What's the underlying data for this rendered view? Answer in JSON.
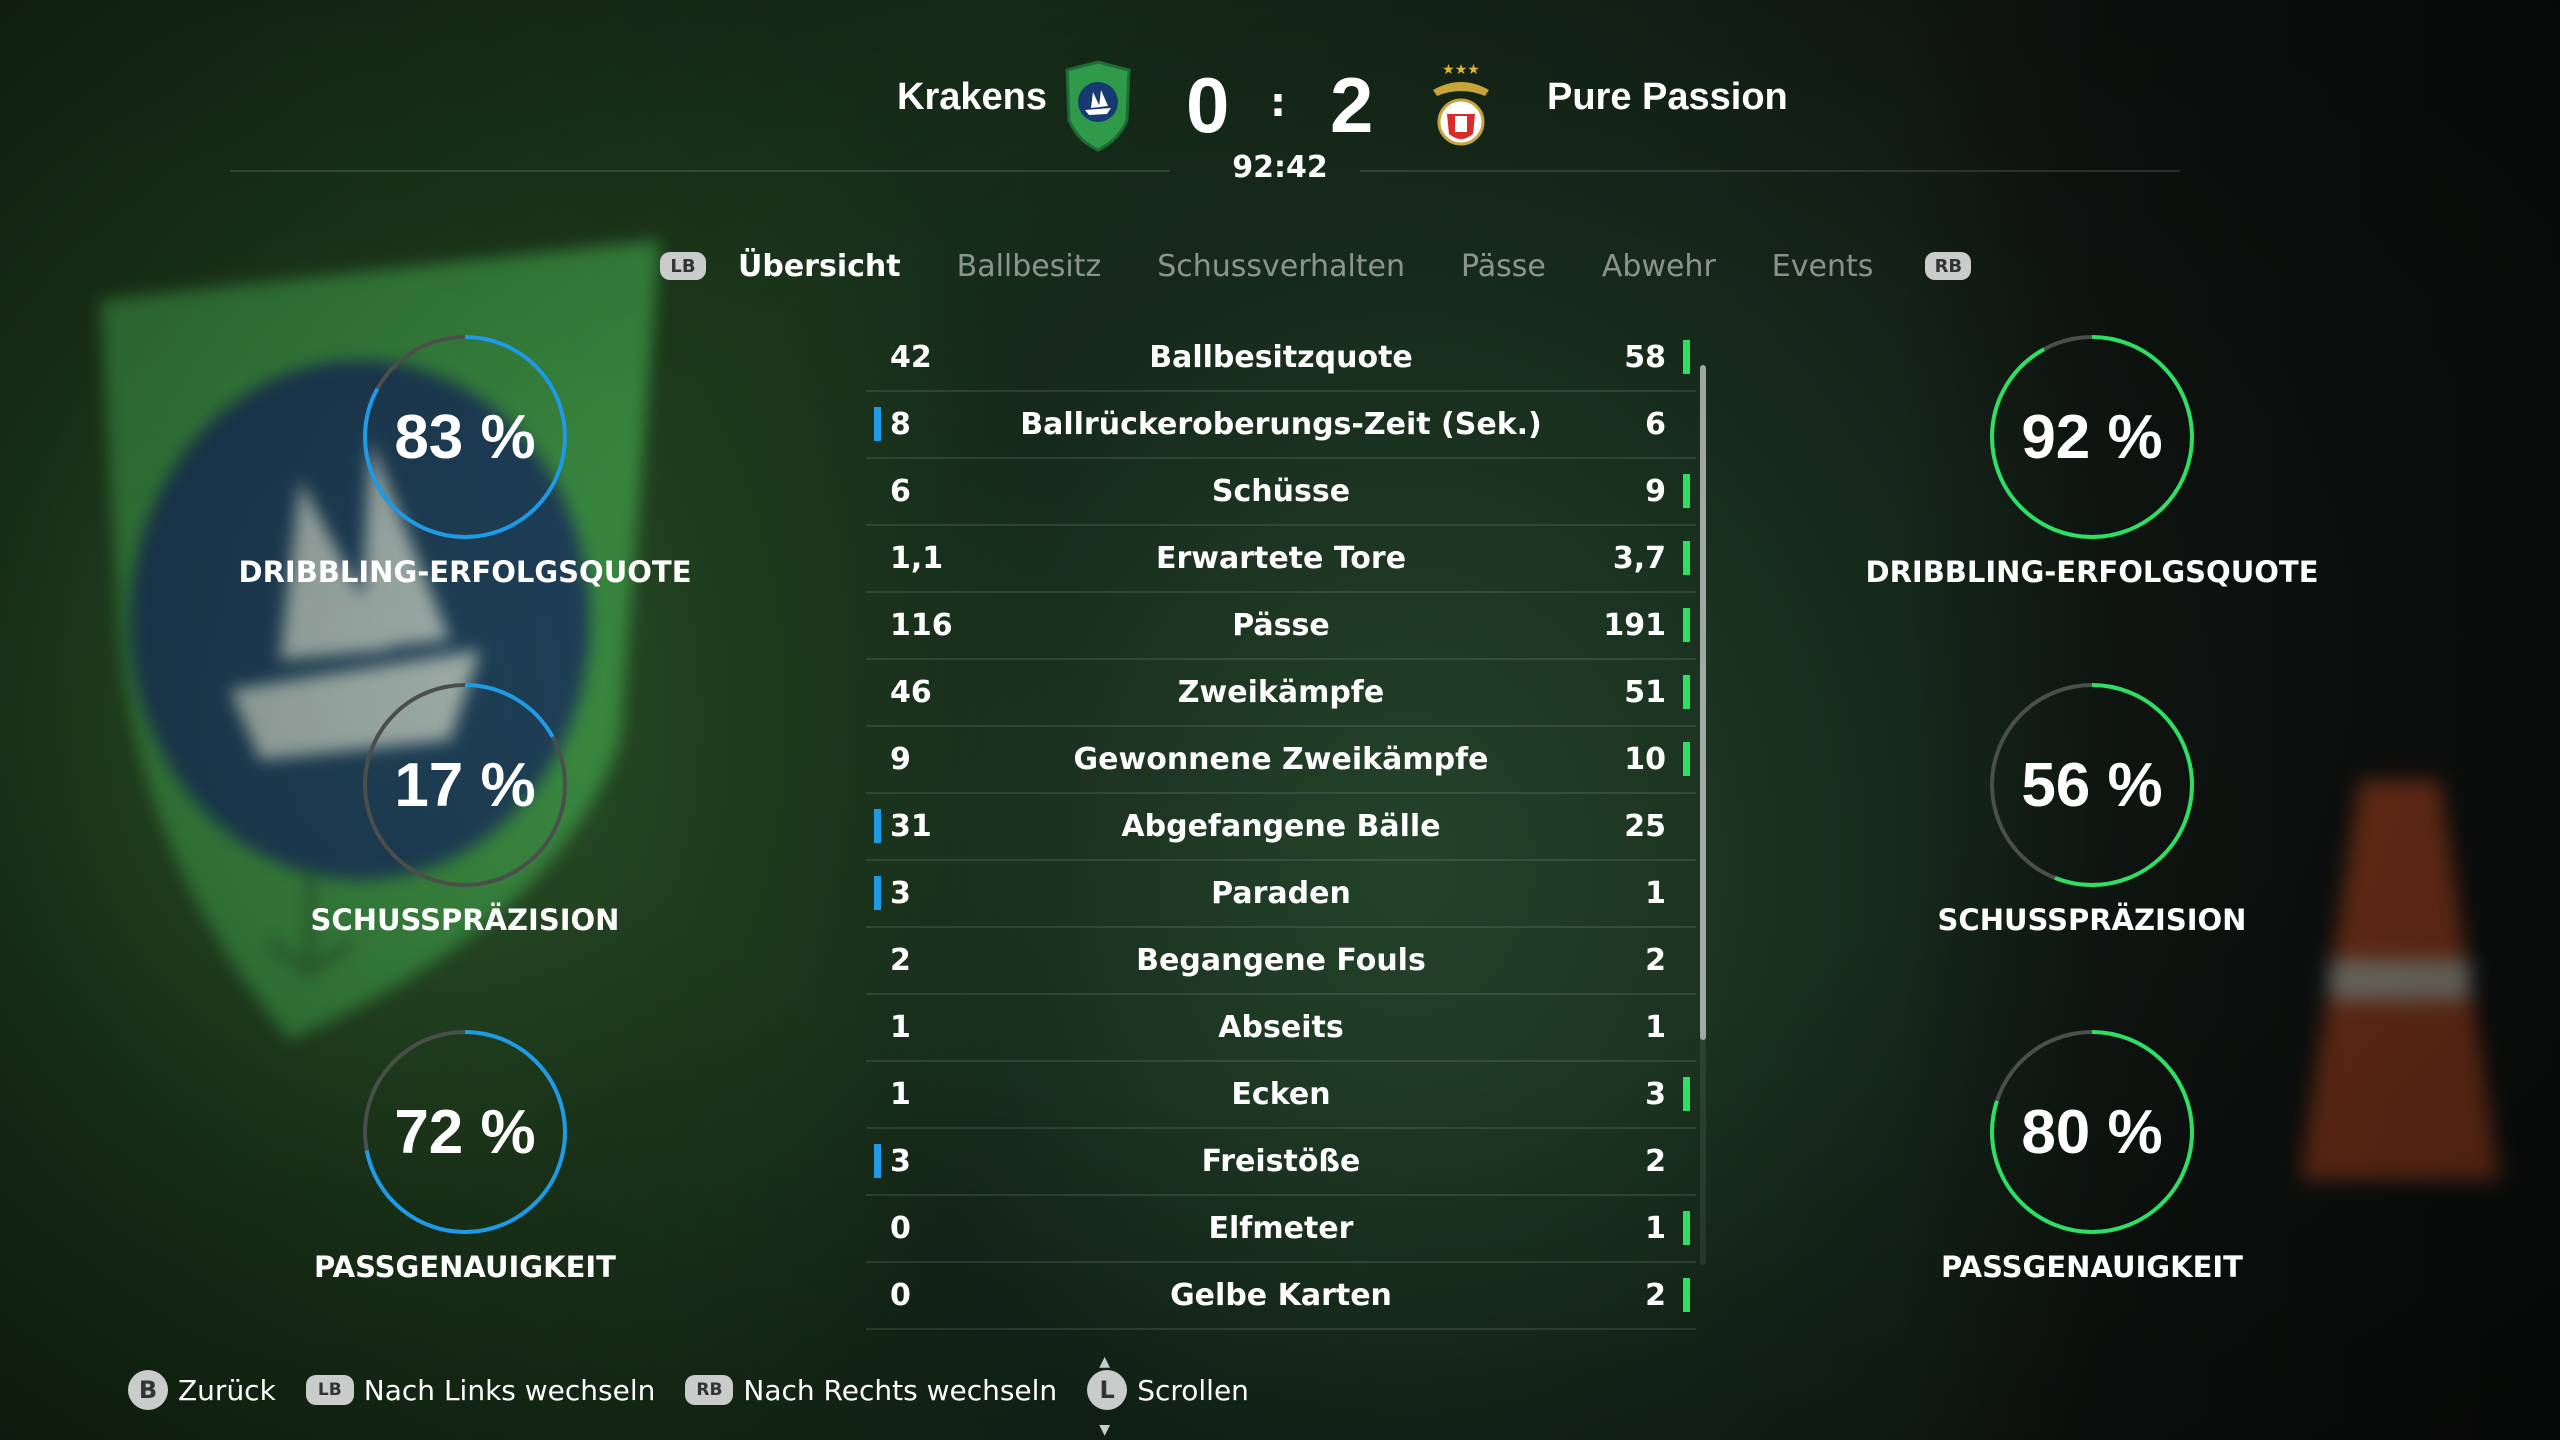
{
  "match": {
    "home_team": "Krakens",
    "away_team": "Pure Passion",
    "home_score": "0",
    "away_score": "2",
    "separator": ":",
    "clock": "92:42"
  },
  "tabs": {
    "left_bumper": "LB",
    "right_bumper": "RB",
    "items": [
      "Übersicht",
      "Ballbesitz",
      "Schussverhalten",
      "Pässe",
      "Abwehr",
      "Events"
    ],
    "active": "Übersicht"
  },
  "home_gauges": [
    {
      "value": "83 %",
      "percent": 83,
      "label": "DRIBBLING-ERFOLGSQUOTE"
    },
    {
      "value": "17 %",
      "percent": 17,
      "label": "SCHUSSPRÄZISION"
    },
    {
      "value": "72 %",
      "percent": 72,
      "label": "PASSGENAUIGKEIT"
    }
  ],
  "away_gauges": [
    {
      "value": "92 %",
      "percent": 92,
      "label": "DRIBBLING-ERFOLGSQUOTE"
    },
    {
      "value": "56 %",
      "percent": 56,
      "label": "SCHUSSPRÄZISION"
    },
    {
      "value": "80 %",
      "percent": 80,
      "label": "PASSGENAUIGKEIT"
    }
  ],
  "stats": [
    {
      "home": "42",
      "label": "Ballbesitzquote",
      "away": "58",
      "leader": "away"
    },
    {
      "home": "8",
      "label": "Ballrückeroberungs-Zeit (Sek.)",
      "away": "6",
      "leader": "home"
    },
    {
      "home": "6",
      "label": "Schüsse",
      "away": "9",
      "leader": "away"
    },
    {
      "home": "1,1",
      "label": "Erwartete Tore",
      "away": "3,7",
      "leader": "away"
    },
    {
      "home": "116",
      "label": "Pässe",
      "away": "191",
      "leader": "away"
    },
    {
      "home": "46",
      "label": "Zweikämpfe",
      "away": "51",
      "leader": "away"
    },
    {
      "home": "9",
      "label": "Gewonnene Zweikämpfe",
      "away": "10",
      "leader": "away"
    },
    {
      "home": "31",
      "label": "Abgefangene Bälle",
      "away": "25",
      "leader": "home"
    },
    {
      "home": "3",
      "label": "Paraden",
      "away": "1",
      "leader": "home"
    },
    {
      "home": "2",
      "label": "Begangene Fouls",
      "away": "2",
      "leader": "none"
    },
    {
      "home": "1",
      "label": "Abseits",
      "away": "1",
      "leader": "none"
    },
    {
      "home": "1",
      "label": "Ecken",
      "away": "3",
      "leader": "away"
    },
    {
      "home": "3",
      "label": "Freistöße",
      "away": "2",
      "leader": "home"
    },
    {
      "home": "0",
      "label": "Elfmeter",
      "away": "1",
      "leader": "away"
    },
    {
      "home": "0",
      "label": "Gelbe Karten",
      "away": "2",
      "leader": "away"
    }
  ],
  "footer": {
    "back_btn": "B",
    "back_label": "Zurück",
    "left_btn": "LB",
    "left_label": "Nach Links wechseln",
    "right_btn": "RB",
    "right_label": "Nach Rechts wechseln",
    "scroll_btn": "L",
    "scroll_label": "Scrollen"
  },
  "colors": {
    "home_accent": "#1e9be6",
    "away_accent": "#2de063",
    "track": "#4a4f4c"
  }
}
